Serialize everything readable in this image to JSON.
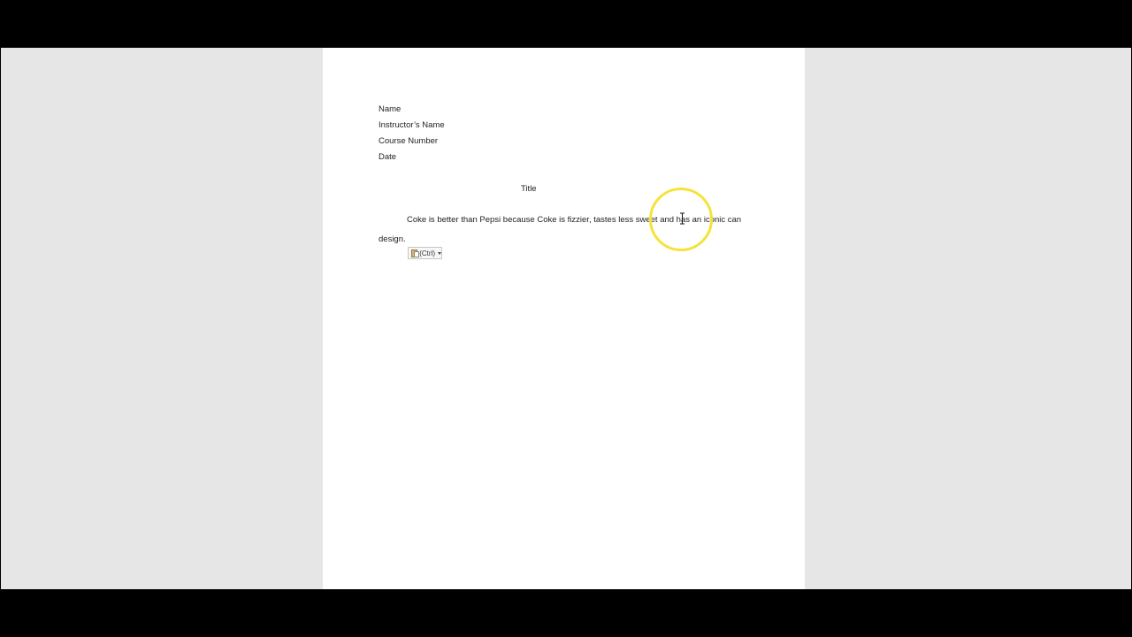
{
  "document": {
    "header_lines": {
      "name": "Name",
      "instructor": "Instructor’s Name",
      "course": "Course Number",
      "date": "Date"
    },
    "title": "Title",
    "body_line_1": "Coke is better than Pepsi because Coke is fizzier, tastes less sweet and has an iconic can",
    "body_line_2": "design."
  },
  "paste_options": {
    "label": "(Ctrl)",
    "icon": "clipboard-icon"
  },
  "overlay": {
    "cursor_highlight_color": "#f5e33a",
    "cursor_icon": "text-cursor-icon"
  },
  "colors": {
    "workspace_bg": "#e6e6e6",
    "page_bg": "#ffffff",
    "letterbox": "#000000"
  }
}
